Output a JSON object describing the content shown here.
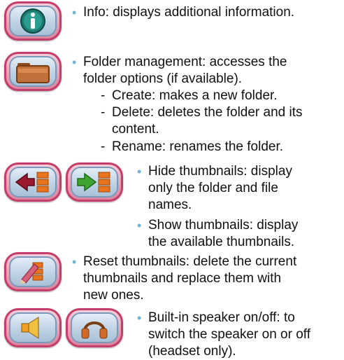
{
  "items": {
    "info": "Info: displays additional information.",
    "folder_l1": "Folder management: accesses the",
    "folder_l2": "folder options (if available).",
    "create": "Create: makes a new folder.",
    "delete_l1": "Delete: deletes the folder and its",
    "delete_l2": "content.",
    "rename": "Rename: renames the folder.",
    "hide_l1": "Hide thumbnails: display",
    "hide_l2": "only the folder and file",
    "hide_l3": "names.",
    "show_l1": "Show thumbnails: display",
    "show_l2": "the available thumbnails.",
    "reset_l1": "Reset thumbnails: delete the current",
    "reset_l2": "thumbnails and replace them with",
    "reset_l3": "new ones.",
    "speaker_l1": "Built-in speaker on/off: to",
    "speaker_l2": "switch the speaker on or off",
    "speaker_l3": "(headset only)."
  },
  "icons": [
    "info-icon",
    "folder-icon",
    "hide-thumbnails-icon",
    "show-thumbnails-icon",
    "reset-thumbnails-icon",
    "speaker-icon",
    "headset-icon"
  ],
  "colors": {
    "bullet": "#6fb3d9",
    "frame": "#c53d6a"
  }
}
